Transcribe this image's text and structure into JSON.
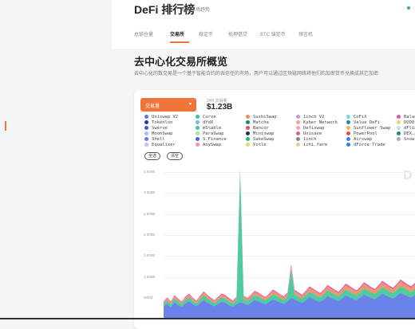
{
  "header": {
    "logo": "DeFi 排行榜",
    "tagline": "把握市场趋势",
    "tabs": [
      {
        "label": "总锁仓量",
        "x": 33
      },
      {
        "label": "交易所",
        "x": 73
      },
      {
        "label": "稳定币",
        "x": 109
      },
      {
        "label": "抵押借贷",
        "x": 146
      },
      {
        "label": "BTC 锚定币",
        "x": 186
      },
      {
        "label": "预言机",
        "x": 234
      }
    ]
  },
  "main": {
    "title": "去中心化交易所概览",
    "description": "去中心化的数交易是一个基于智能合约的去信任的市场，用户可以通过区块链网络将他们的加密货币兑换成其它加密"
  },
  "chart_card": {
    "dex_select": "交易量",
    "volume_label": "24H 交易量",
    "volume_value": "$1.23B",
    "select_all": "全选",
    "clear": "清空",
    "watermark": "D"
  },
  "legend": [
    {
      "name": "Uniswap V2",
      "color": "#5b74e6"
    },
    {
      "name": "Curve",
      "color": "#3cc596"
    },
    {
      "name": "SushiSwap",
      "color": "#f08a5d"
    },
    {
      "name": "1inch V2",
      "color": "#b39ddb"
    },
    {
      "name": "CoFiX",
      "color": "#7ed6df"
    },
    {
      "name": "Balancer",
      "color": "#e056a0"
    },
    {
      "name": "Tokenlon",
      "color": "#2d3aa6"
    },
    {
      "name": "dYdX",
      "color": "#7fb3f5"
    },
    {
      "name": "Matcha",
      "color": "#1e8a5e"
    },
    {
      "name": "Kyber Network",
      "color": "#f3a683"
    },
    {
      "name": "Value DeFi",
      "color": "#1e88a8"
    },
    {
      "name": "DODO",
      "color": "#f6d365"
    },
    {
      "name": "Swerve",
      "color": "#3a5bd9"
    },
    {
      "name": "mStable",
      "color": "#4fc3a1"
    },
    {
      "name": "Bancor",
      "color": "#e8505b"
    },
    {
      "name": "Defiswap",
      "color": "#f7a6b8"
    },
    {
      "name": "Sunflower Swap",
      "color": "#ffb142"
    },
    {
      "name": "dFlink",
      "color": "#b5e3f0"
    },
    {
      "name": "MoonSwap",
      "color": "#9fc5f8"
    },
    {
      "name": "ParaSwap",
      "color": "#a8e6a1"
    },
    {
      "name": "Miniswap",
      "color": "#2c2c54"
    },
    {
      "name": "Unisave",
      "color": "#cf6a87"
    },
    {
      "name": "PowerPool",
      "color": "#e55039"
    },
    {
      "name": "DEX.AG",
      "color": "#218c74"
    },
    {
      "name": "Shell",
      "color": "#6c7ae0"
    },
    {
      "name": "S.Finance",
      "color": "#3867d6"
    },
    {
      "name": "SakeSwap",
      "color": "#20bf6b"
    },
    {
      "name": "1inch",
      "color": "#778ca3"
    },
    {
      "name": "Airswap",
      "color": "#4b7bec"
    },
    {
      "name": "Snowswap",
      "color": "#a5b1c2"
    },
    {
      "name": "Equalizer",
      "color": "#d1b3ff"
    },
    {
      "name": "AnySwap",
      "color": "#f78fb3"
    },
    {
      "name": "Yotle",
      "color": "#f5cd79"
    },
    {
      "name": "ichi.farm",
      "color": "#f8c291"
    },
    {
      "name": "dForce Trade",
      "color": "#2e86de"
    }
  ],
  "yaxis": {
    "ticks": [
      "3.500B",
      "3.000B",
      "2.500B",
      "2.000B",
      "1.500B",
      "1.000B",
      "500M"
    ],
    "values": [
      3500000000,
      3000000000,
      2500000000,
      2000000000,
      1500000000,
      1000000000,
      500000000
    ],
    "ylim": [
      0,
      3500000000
    ]
  },
  "colors": {
    "accent": "#f0753b"
  },
  "chart_data": {
    "type": "area",
    "ylim": [
      0,
      3500000000
    ],
    "series": [
      {
        "name": "Uniswap V2",
        "color": "#5b74e6",
        "values": [
          300,
          360,
          280,
          400,
          330,
          290,
          370,
          420,
          350,
          300,
          380,
          450,
          390,
          340,
          300,
          360,
          410,
          380,
          330,
          290,
          350,
          400,
          370,
          330,
          390,
          450,
          420,
          380,
          350,
          410,
          470,
          430,
          390,
          360,
          420,
          500,
          460,
          420,
          380,
          440,
          520,
          480,
          440,
          410,
          470,
          540,
          500,
          460,
          430,
          490,
          560,
          520,
          480,
          450,
          510,
          580,
          540,
          500,
          470,
          530,
          600,
          560,
          520,
          490,
          550,
          620,
          580,
          540,
          510,
          570
        ]
      },
      {
        "name": "Curve",
        "color": "#3cc596",
        "values": [
          60,
          80,
          70,
          90,
          75,
          65,
          85,
          95,
          80,
          70,
          90,
          110,
          95,
          85,
          75,
          90,
          100,
          95,
          85,
          75,
          90,
          3100,
          95,
          85,
          100,
          115,
          110,
          100,
          90,
          105,
          120,
          115,
          100,
          95,
          110,
          700,
          120,
          110,
          100,
          115,
          130,
          125,
          115,
          105,
          120,
          140,
          130,
          120,
          110,
          125,
          145,
          135,
          125,
          115,
          130,
          150,
          140,
          130,
          120,
          135,
          155,
          145,
          135,
          125,
          140,
          160,
          150,
          140,
          130,
          145
        ]
      },
      {
        "name": "SushiSwap",
        "color": "#f08a5d",
        "values": [
          40,
          50,
          45,
          55,
          50,
          45,
          55,
          60,
          50,
          45,
          55,
          65,
          60,
          55,
          50,
          55,
          65,
          60,
          55,
          50,
          55,
          65,
          60,
          55,
          60,
          70,
          65,
          60,
          55,
          65,
          75,
          70,
          65,
          60,
          70,
          80,
          75,
          70,
          65,
          75,
          85,
          80,
          75,
          70,
          80,
          90,
          85,
          80,
          75,
          85,
          95,
          90,
          85,
          80,
          90,
          100,
          95,
          90,
          85,
          95,
          105,
          100,
          95,
          90,
          100,
          110,
          105,
          100,
          95,
          105
        ]
      },
      {
        "name": "Balancer",
        "color": "#e056a0",
        "values": [
          20,
          25,
          22,
          28,
          24,
          21,
          26,
          30,
          25,
          22,
          27,
          32,
          29,
          26,
          23,
          27,
          31,
          29,
          26,
          23,
          27,
          31,
          29,
          26,
          29,
          34,
          32,
          29,
          27,
          31,
          36,
          34,
          31,
          29,
          33,
          38,
          36,
          34,
          31,
          35,
          40,
          38,
          35,
          33,
          37,
          42,
          40,
          37,
          35,
          39,
          44,
          42,
          39,
          37,
          41,
          46,
          44,
          41,
          39,
          43,
          48,
          46,
          43,
          41,
          45,
          50,
          48,
          45,
          43,
          47
        ]
      }
    ]
  }
}
